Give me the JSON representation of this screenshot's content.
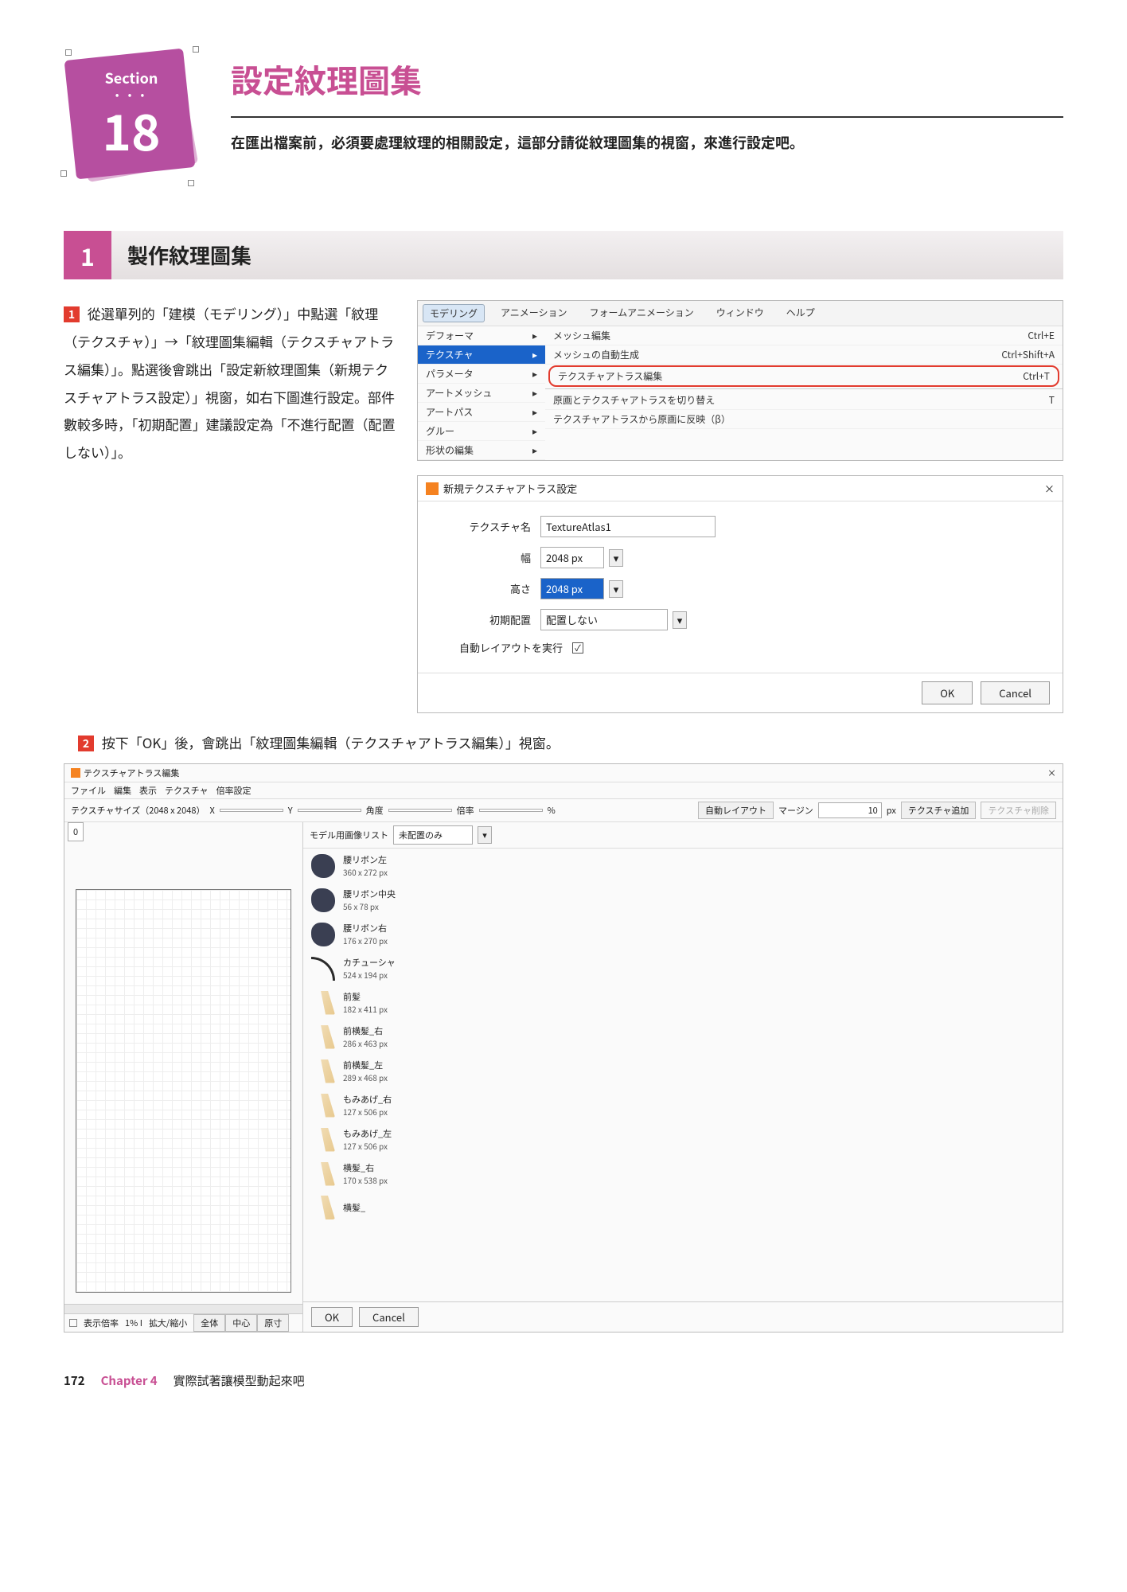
{
  "header": {
    "section_label": "Section",
    "section_number": "18",
    "title": "設定紋理圖集",
    "subtitle": "在匯出檔案前，必須要處理紋理的相關設定，這部分請從紋理圖集的視窗，來進行設定吧。"
  },
  "section1": {
    "num": "1",
    "title": "製作紋理圖集",
    "step1_mark": "1",
    "step1_text": " 從選單列的「建模（モデリング）」中點選「紋理（テクスチャ）」→「紋理圖集編輯（テクスチャアトラス編集）」。點選後會跳出「設定新紋理圖集（新規テクスチャアトラス設定）」視窗，如右下圖進行設定。部件數較多時，「初期配置」建議設定為「不進行配置（配置しない）」。",
    "step2_mark": "2",
    "step2_text": " 按下「OK」後，會跳出「紋理圖集編輯（テクスチャアトラス編集）」視窗。"
  },
  "menu_shot": {
    "tabs": [
      "モデリング",
      "アニメーション",
      "フォームアニメーション",
      "ウィンドウ",
      "ヘルプ"
    ],
    "left_items": [
      "デフォーマ",
      "テクスチャ",
      "パラメータ",
      "アートメッシュ",
      "アートパス",
      "グルー",
      "形状の編集"
    ],
    "right_items": [
      {
        "label": "メッシュ編集",
        "sc": "Ctrl+E"
      },
      {
        "label": "メッシュの自動生成",
        "sc": "Ctrl+Shift+A"
      },
      {
        "label": "テクスチャアトラス編集",
        "sc": "Ctrl+T",
        "hl": true
      },
      {
        "label": "原画とテクスチャアトラスを切り替え",
        "sc": "T",
        "sep": true
      },
      {
        "label": "テクスチャアトラスから原画に反映（β）",
        "sc": ""
      }
    ]
  },
  "dialog": {
    "title": "新規テクスチャアトラス設定",
    "close": "×",
    "rows": {
      "name_lbl": "テクスチャ名",
      "name_val": "TextureAtlas1",
      "w_lbl": "幅",
      "w_val": "2048 px",
      "h_lbl": "高さ",
      "h_val": "2048 px",
      "init_lbl": "初期配置",
      "init_val": "配置しない",
      "auto_lbl": "自動レイアウトを実行",
      "auto_chk": "✓"
    },
    "ok": "OK",
    "cancel": "Cancel"
  },
  "editor": {
    "title": "テクスチャアトラス編集",
    "close": "×",
    "menu": [
      "ファイル",
      "編集",
      "表示",
      "テクスチャ",
      "倍率設定"
    ],
    "toolbar": {
      "size_lbl": "テクスチャサイズ（2048 x 2048）",
      "x_lbl": "X",
      "y_lbl": "Y",
      "ang_lbl": "角度",
      "rate_lbl": "倍率",
      "pct": "%",
      "auto_btn": "自動レイアウト",
      "margin_lbl": "マージン",
      "margin_val": "10",
      "margin_unit": "px",
      "add_btn": "テクスチャ追加",
      "del_btn": "テクスチャ削除"
    },
    "tab_val": "0",
    "list_header": {
      "lbl": "モデル用画像リスト",
      "dd": "未配置のみ"
    },
    "items": [
      {
        "name": "腰リボン左",
        "size": "360 x 272 px",
        "t": "blob"
      },
      {
        "name": "腰リボン中央",
        "size": "56 x 78 px",
        "t": "blob"
      },
      {
        "name": "腰リボン右",
        "size": "176 x 270 px",
        "t": "blob"
      },
      {
        "name": "カチューシャ",
        "size": "524 x 194 px",
        "t": "arc"
      },
      {
        "name": "前髪",
        "size": "182 x 411 px",
        "t": "hair"
      },
      {
        "name": "前横髪_右",
        "size": "286 x 463 px",
        "t": "hair"
      },
      {
        "name": "前横髪_左",
        "size": "289 x 468 px",
        "t": "hair"
      },
      {
        "name": "もみあげ_右",
        "size": "127 x 506 px",
        "t": "hair"
      },
      {
        "name": "もみあげ_左",
        "size": "127 x 506 px",
        "t": "hair"
      },
      {
        "name": "横髪_右",
        "size": "170 x 538 px",
        "t": "hair"
      },
      {
        "name": "横髪_",
        "size": "",
        "t": "hair"
      }
    ],
    "status": {
      "lbl": "表示倍率",
      "val": "1% I",
      "zoom": "拡大/縮小",
      "btns": [
        "全体",
        "中心",
        "原寸"
      ]
    },
    "ok": "OK",
    "cancel": "Cancel"
  },
  "footer": {
    "page": "172",
    "chapter": "Chapter 4",
    "chapter_title": "實際試著讓模型動起來吧"
  }
}
